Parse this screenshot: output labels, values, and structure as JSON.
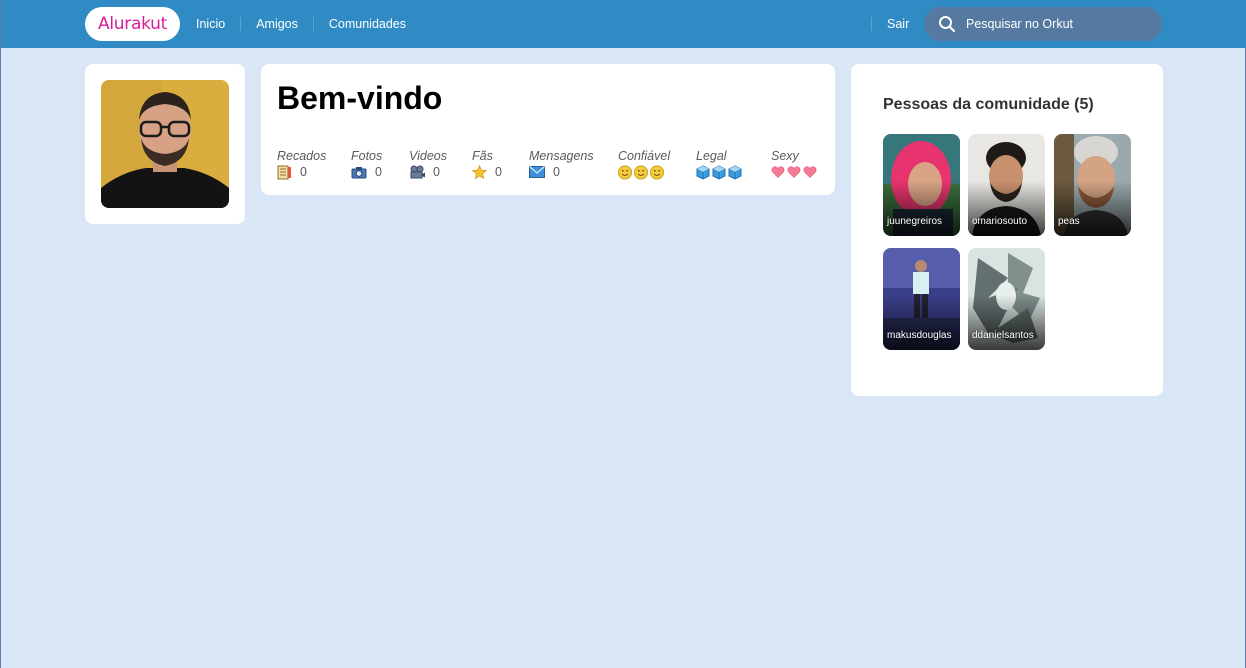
{
  "header": {
    "logo": "Alurakut",
    "nav": [
      "Inicio",
      "Amigos",
      "Comunidades"
    ],
    "logout": "Sair",
    "search_placeholder": "Pesquisar no Orkut"
  },
  "welcome": {
    "title": "Bem-vindo",
    "stats": [
      {
        "label": "Recados",
        "value": "0",
        "icon": "notebook-icon"
      },
      {
        "label": "Fotos",
        "value": "0",
        "icon": "camera-icon"
      },
      {
        "label": "Videos",
        "value": "0",
        "icon": "video-camera-icon"
      },
      {
        "label": "Fãs",
        "value": "0",
        "icon": "star-icon"
      },
      {
        "label": "Mensagens",
        "value": "0",
        "icon": "envelope-icon"
      }
    ],
    "ratings": [
      {
        "label": "Confiável",
        "icon": "smiley-icon",
        "count": 3
      },
      {
        "label": "Legal",
        "icon": "ice-cube-icon",
        "count": 3
      },
      {
        "label": "Sexy",
        "icon": "heart-icon",
        "count": 3
      }
    ]
  },
  "community": {
    "title": "Pessoas da comunidade (5)",
    "people": [
      "juunegreiros",
      "omariosouto",
      "peas",
      "makusdouglas",
      "ddanielsantos"
    ]
  },
  "colors": {
    "topbar": "#308bc5",
    "background": "#d9e6f6",
    "logo": "#d81d99",
    "search": "#5579a1"
  }
}
